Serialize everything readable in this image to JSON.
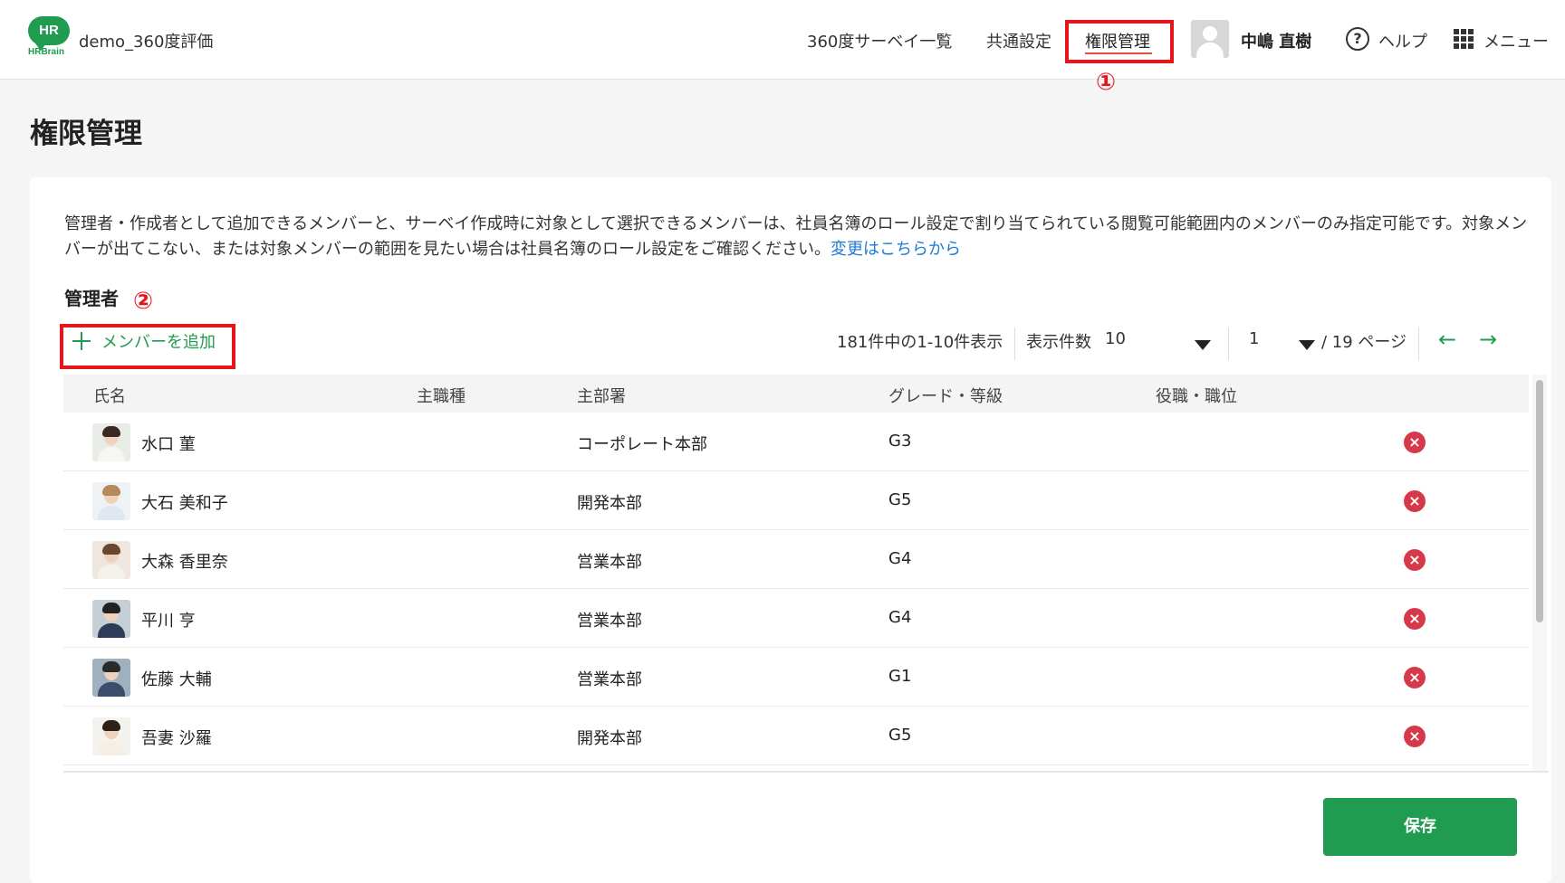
{
  "header": {
    "logo_text": "HRBrain",
    "logo_badge": "HR",
    "app_title": "demo_360度評価",
    "nav": [
      {
        "label": "360度サーベイ一覧"
      },
      {
        "label": "共通設定"
      },
      {
        "label": "権限管理"
      }
    ],
    "user_name": "中嶋 直樹",
    "help_icon_glyph": "?",
    "help_label": "ヘルプ",
    "menu_label": "メニュー"
  },
  "annotations": {
    "marker1": "①",
    "marker2": "②",
    "color": "#e6141b"
  },
  "page_title": "権限管理",
  "notice": {
    "text": "管理者・作成者として追加できるメンバーと、サーベイ作成時に対象として選択できるメンバーは、社員名簿のロール設定で割り当てられている閲覧可能範囲内のメンバーのみ指定可能です。対象メンバーが出てこない、または対象メンバーの範囲を見たい場合は社員名簿のロール設定をご確認ください。",
    "link": "変更はこちらから"
  },
  "section_label": "管理者",
  "add_member_label": "メンバーを追加",
  "pagination": {
    "summary": "181件中の1-10件表示",
    "per_page_label": "表示件数",
    "per_page_value": "10",
    "current_page": "1",
    "total_pages": "/ 19 ページ",
    "prev_arrow": "←",
    "next_arrow": "→"
  },
  "table": {
    "columns": [
      "氏名",
      "主職種",
      "主部署",
      "グレード・等級",
      "役職・職位"
    ],
    "rows": [
      {
        "name": "水口 菫",
        "job": "",
        "dept": "コーポレート本部",
        "grade": "G3",
        "position": ""
      },
      {
        "name": "大石 美和子",
        "job": "",
        "dept": "開発本部",
        "grade": "G5",
        "position": ""
      },
      {
        "name": "大森 香里奈",
        "job": "",
        "dept": "営業本部",
        "grade": "G4",
        "position": ""
      },
      {
        "name": "平川 亨",
        "job": "",
        "dept": "営業本部",
        "grade": "G4",
        "position": ""
      },
      {
        "name": "佐藤 大輔",
        "job": "",
        "dept": "営業本部",
        "grade": "G1",
        "position": ""
      },
      {
        "name": "吾妻 沙羅",
        "job": "",
        "dept": "開発本部",
        "grade": "G5",
        "position": ""
      }
    ],
    "remove_glyph": "×"
  },
  "save_label": "保存",
  "colors": {
    "brand_green": "#1f9c4f",
    "remove_red": "#d63a4a",
    "link_blue": "#1e7bd6"
  }
}
